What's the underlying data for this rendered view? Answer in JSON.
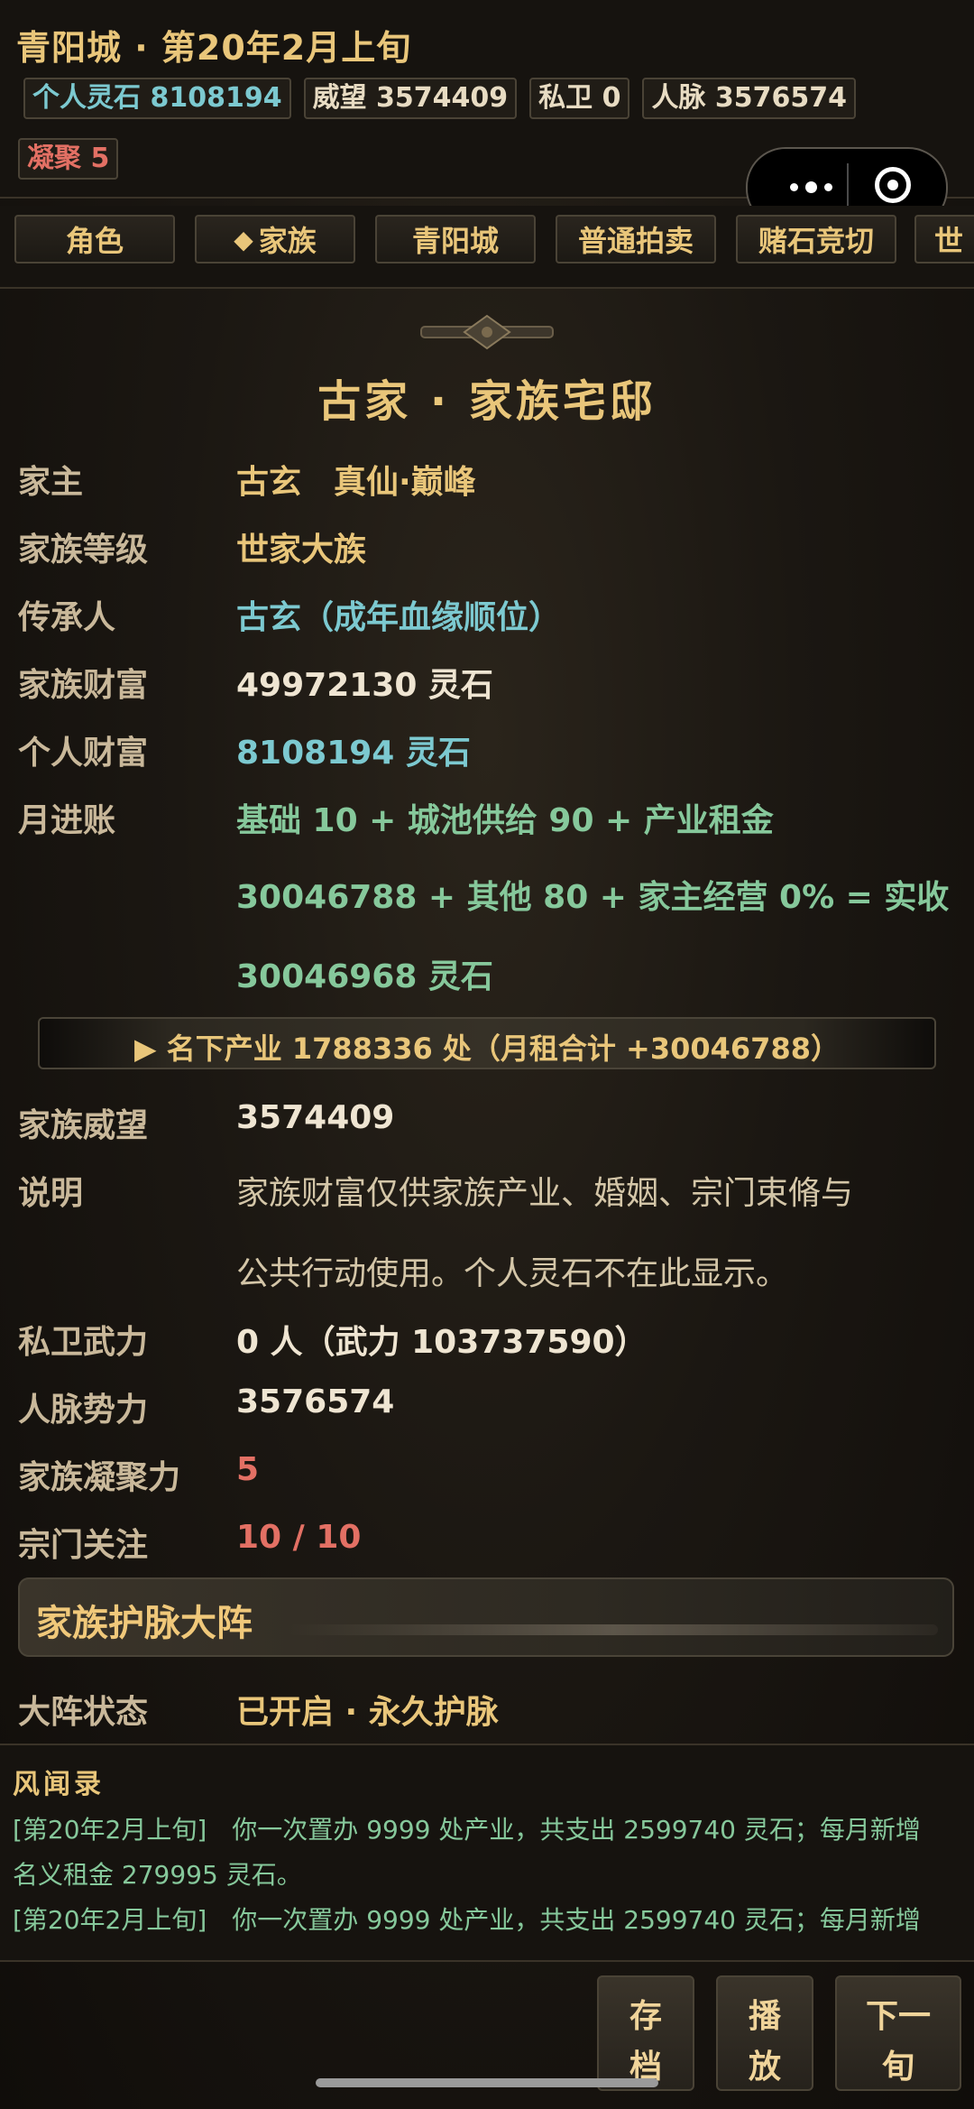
{
  "header": {
    "title": "青阳城 · 第20年2月上旬",
    "stats": {
      "lingshi": "个人灵石 8108194",
      "weiwang": "威望 3574409",
      "siwei": "私卫 0",
      "renmai": "人脉 3576574",
      "ningju": "凝聚 5"
    }
  },
  "tabs": {
    "role": "角色",
    "family": "家族",
    "qingyang": "青阳城",
    "auction": "普通拍卖",
    "gamble": "赌石竞切",
    "world": "世"
  },
  "main": {
    "heading": "古家 · 家族宅邸",
    "rows": {
      "head_label": "家主",
      "head_value": "古玄　真仙·巅峰",
      "level_label": "家族等级",
      "level_value": "世家大族",
      "heir_label": "传承人",
      "heir_value": "古玄（成年血缘顺位）",
      "wealth_label": "家族财富",
      "wealth_value": "49972130 灵石",
      "personal_label": "个人财富",
      "personal_value": "8108194 灵石",
      "income_label": "月进账",
      "income_line1": "基础 10 + 城池供给 90 + 产业租金",
      "income_line2": "30046788 + 其他 80 + 家主经营 0% = 实收",
      "income_line3": "30046968 灵石",
      "property_banner": "▶ 名下产业 1788336 处（月租合计 +30046788）",
      "prestige_label": "家族威望",
      "prestige_value": "3574409",
      "note_label": "说明",
      "note_line1": "家族财富仅供家族产业、婚姻、宗门束脩与",
      "note_line2": "公共行动使用。个人灵石不在此显示。",
      "guard_label": "私卫武力",
      "guard_value": "0 人（武力 103737590）",
      "network_label": "人脉势力",
      "network_value": "3576574",
      "cohesion_label": "家族凝聚力",
      "cohesion_value": "5",
      "sect_label": "宗门关注",
      "sect_value": "10 / 10"
    },
    "section_title": "家族护脉大阵",
    "array_label": "大阵状态",
    "array_value": "已开启 · 永久护脉"
  },
  "log": {
    "title": "风闻录",
    "line1": "[第20年2月上旬]　你一次置办 9999 处产业，共支出 2599740 灵石；每月新增",
    "line2": "名义租金 279995 灵石。",
    "line3": "[第20年2月上旬]　你一次置办 9999 处产业，共支出 2599740 灵石；每月新增"
  },
  "buttons": {
    "save_1": "存",
    "save_2": "档",
    "play_1": "播",
    "play_2": "放",
    "next_1": "下一",
    "next_2": "旬"
  }
}
